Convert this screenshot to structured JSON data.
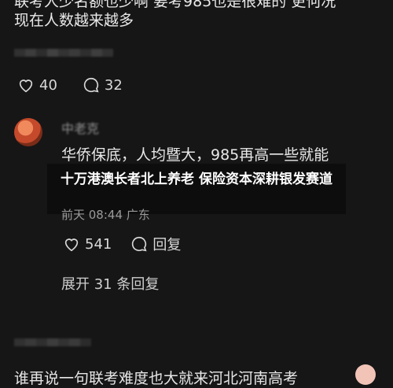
{
  "post": {
    "partial_line": "联考人少名额也少啊 要考985也是很难的 更何况",
    "line2": "现在人数越来越多",
    "likes": "40",
    "comments": "32"
  },
  "reply": {
    "username": "中老克",
    "text": "华侨保底，人均暨大，985再高一些就能",
    "meta_time": "前天 08:44",
    "meta_location": "广东",
    "likes": "541",
    "reply_label": "回复"
  },
  "overlay": {
    "title": "十万港澳长者北上养老 保险资本深耕银发赛道"
  },
  "expand_label": "展开 31 条回复",
  "next_post": {
    "text": "谁再说一句联考难度也大就来河北河南高考"
  },
  "icons": [
    "heart-icon",
    "comment-icon",
    "reply-icon",
    "avatar"
  ]
}
